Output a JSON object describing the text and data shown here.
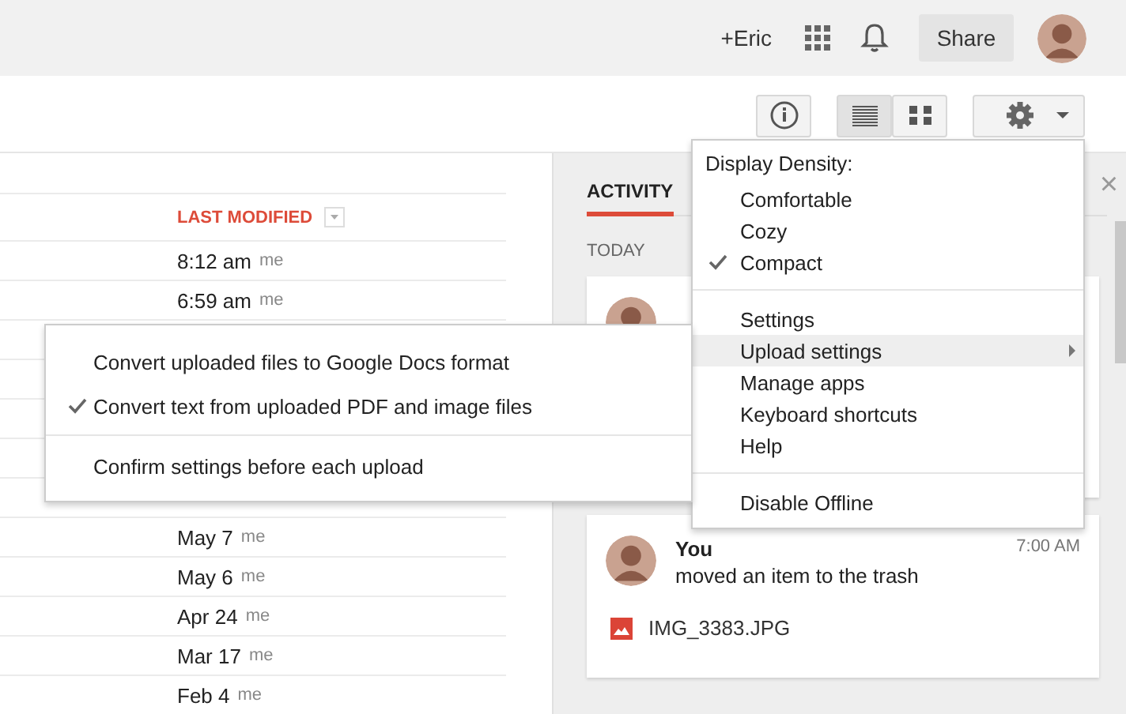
{
  "top_bar": {
    "user": "+Eric",
    "share_button": "Share"
  },
  "toolbar": {
    "view_toggle": [
      {
        "kind": "list",
        "selected": true
      },
      {
        "kind": "grid",
        "selected": false
      }
    ]
  },
  "table": {
    "column": "LAST MODIFIED",
    "rows_top": [
      {
        "date": "8:12 am",
        "owner": "me"
      },
      {
        "date": "6:59 am",
        "owner": "me"
      }
    ],
    "rows_bottom": [
      {
        "date": "May 7",
        "owner": "me"
      },
      {
        "date": "May 6",
        "owner": "me"
      },
      {
        "date": "Apr 24",
        "owner": "me"
      },
      {
        "date": "Mar 17",
        "owner": "me"
      },
      {
        "date": "Feb 4",
        "owner": "me"
      }
    ]
  },
  "activity_panel": {
    "tab": "ACTIVITY",
    "close": "×",
    "section": "TODAY",
    "cards": [
      {
        "kind": "covered"
      },
      {
        "kind": "activity",
        "user": "You",
        "time": "7:00 AM",
        "action": "moved an item to the trash",
        "file": "IMG_3383.JPG"
      }
    ]
  },
  "settings_menu": {
    "heading": "Display Density:",
    "items": [
      {
        "kind": "option",
        "label": "Comfortable",
        "checked": false
      },
      {
        "kind": "option",
        "label": "Cozy",
        "checked": false
      },
      {
        "kind": "option",
        "label": "Compact",
        "checked": true
      },
      {
        "kind": "divider"
      },
      {
        "kind": "item",
        "label": "Settings",
        "highlighted": false
      },
      {
        "kind": "submenu",
        "label": "Upload settings",
        "highlighted": true
      },
      {
        "kind": "item",
        "label": "Manage apps",
        "highlighted": false
      },
      {
        "kind": "item",
        "label": "Keyboard shortcuts",
        "highlighted": false
      },
      {
        "kind": "item",
        "label": "Help",
        "highlighted": false
      },
      {
        "kind": "divider"
      },
      {
        "kind": "item",
        "label": "Disable Offline",
        "highlighted": false
      }
    ]
  },
  "upload_submenu": {
    "items": [
      {
        "kind": "option",
        "label": "Convert uploaded files to Google Docs format",
        "checked": false
      },
      {
        "kind": "option",
        "label": "Convert text from uploaded PDF and image files",
        "checked": true
      },
      {
        "kind": "divider"
      },
      {
        "kind": "option",
        "label": "Confirm settings before each upload",
        "checked": false
      }
    ]
  }
}
